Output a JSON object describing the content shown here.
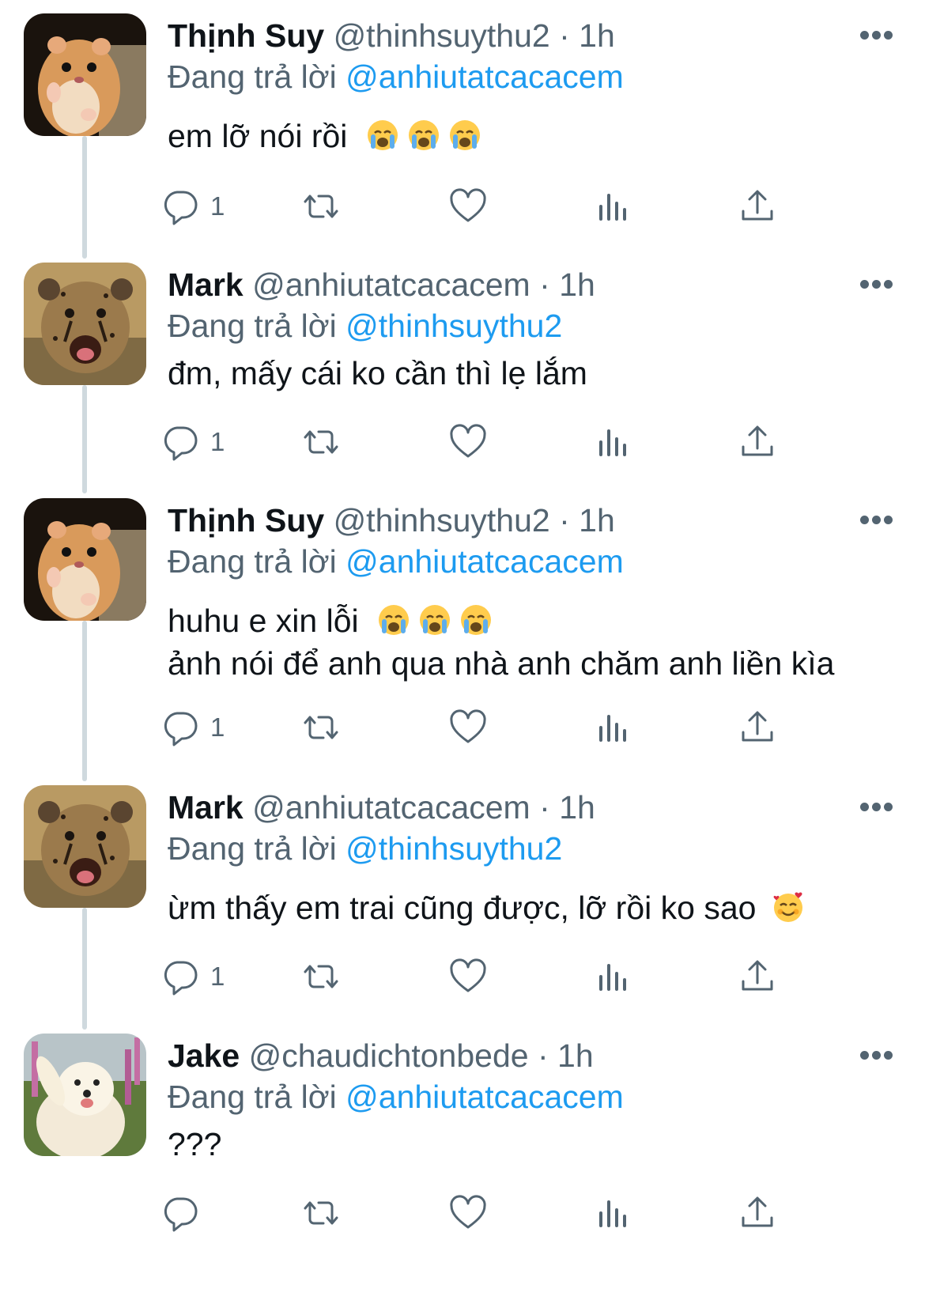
{
  "reply_prefix": "Đang trả lời",
  "tweets": [
    {
      "name": "Thịnh Suy",
      "handle": "@thinhsuythu2",
      "sep": "·",
      "time": "1h",
      "reply_to": "@anhiutatcacacem",
      "text_lines": [
        "em lỡ nói rồi"
      ],
      "emoji": [
        "crying-face",
        "crying-face",
        "crying-face"
      ],
      "avatar": "hamster",
      "reply_count": "1"
    },
    {
      "name": "Mark",
      "handle": "@anhiutatcacacem",
      "sep": "·",
      "time": "1h",
      "reply_to": "@thinhsuythu2",
      "text_lines": [
        "đm, mấy cái ko cần thì lẹ lắm"
      ],
      "emoji": [],
      "avatar": "cheetah-cub",
      "reply_count": "1"
    },
    {
      "name": "Thịnh Suy",
      "handle": "@thinhsuythu2",
      "sep": "·",
      "time": "1h",
      "reply_to": "@anhiutatcacacem",
      "text_lines": [
        "huhu e xin lỗi",
        "ảnh nói để anh qua nhà anh chăm anh liền kìa"
      ],
      "emoji": [
        "crying-face",
        "crying-face",
        "crying-face"
      ],
      "avatar": "hamster",
      "reply_count": "1"
    },
    {
      "name": "Mark",
      "handle": "@anhiutatcacacem",
      "sep": "·",
      "time": "1h",
      "reply_to": "@thinhsuythu2",
      "text_lines": [
        "ừm thấy em trai cũng được, lỡ rồi ko sao"
      ],
      "emoji": [
        "smiling-face-with-hearts"
      ],
      "avatar": "cheetah-cub",
      "reply_count": "1"
    },
    {
      "name": "Jake",
      "handle": "@chaudichtonbede",
      "sep": "·",
      "time": "1h",
      "reply_to": "@anhiutatcacacem",
      "text_lines": [
        "???"
      ],
      "emoji": [],
      "avatar": "samoyed-dog",
      "reply_count": ""
    }
  ],
  "colors": {
    "text": "#0f1419",
    "muted": "#536471",
    "link": "#1d9bf0",
    "thread_line": "#cfd9de"
  },
  "action_icons": [
    "reply-icon",
    "retweet-icon",
    "like-icon",
    "analytics-icon",
    "share-icon"
  ]
}
